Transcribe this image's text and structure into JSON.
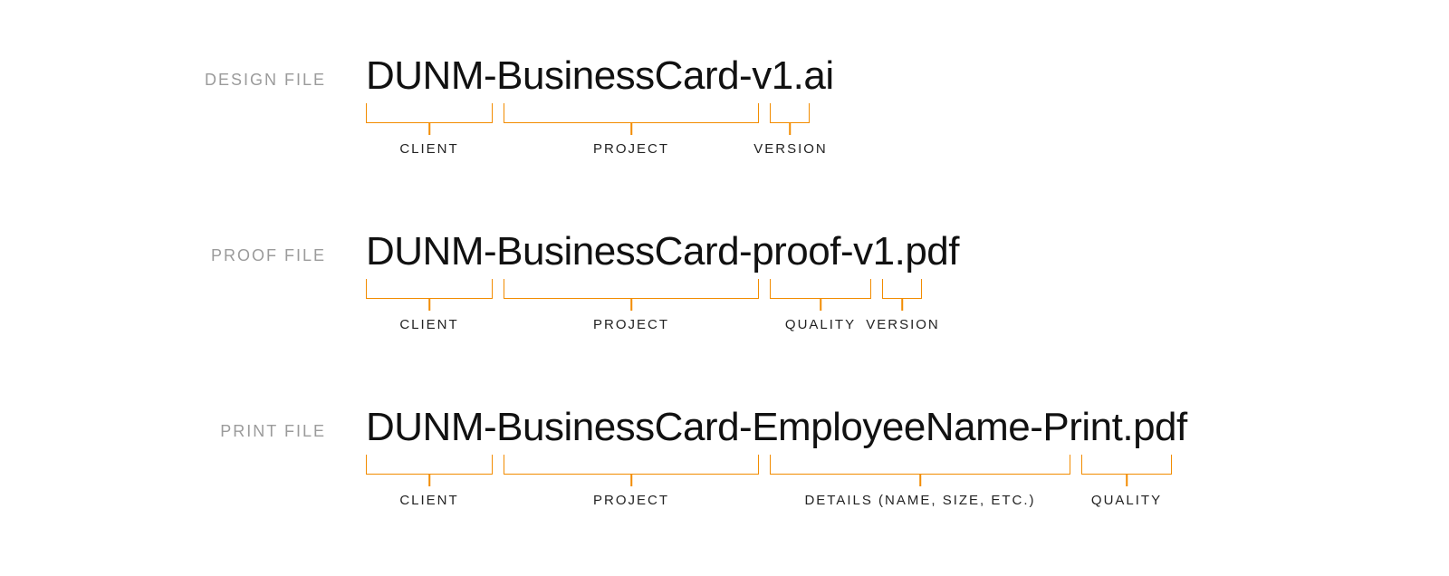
{
  "rows": [
    {
      "label": "DESIGN FILE",
      "filename": "DUNM-BusinessCard-v1.ai",
      "segments": [
        {
          "label": "CLIENT",
          "text": "DUNM"
        },
        {
          "label": "PROJECT",
          "text": "BusinessCard"
        },
        {
          "label": "VERSION",
          "text": "v1"
        }
      ],
      "extension": ".ai"
    },
    {
      "label": "PROOF FILE",
      "filename": "DUNM-BusinessCard-proof-v1.pdf",
      "segments": [
        {
          "label": "CLIENT",
          "text": "DUNM"
        },
        {
          "label": "PROJECT",
          "text": "BusinessCard"
        },
        {
          "label": "QUALITY",
          "text": "proof"
        },
        {
          "label": "VERSION",
          "text": "v1"
        }
      ],
      "extension": ".pdf"
    },
    {
      "label": "PRINT FILE",
      "filename": "DUNM-BusinessCard-EmployeeName-Print.pdf",
      "segments": [
        {
          "label": "CLIENT",
          "text": "DUNM"
        },
        {
          "label": "PROJECT",
          "text": "BusinessCard"
        },
        {
          "label": "DETAILS (NAME, SIZE, ETC.)",
          "text": "EmployeeName"
        },
        {
          "label": "QUALITY",
          "text": "Print"
        }
      ],
      "extension": ".pdf"
    }
  ],
  "colors": {
    "accent": "#f28c00",
    "muted": "#9b9b9b",
    "text": "#111111"
  }
}
